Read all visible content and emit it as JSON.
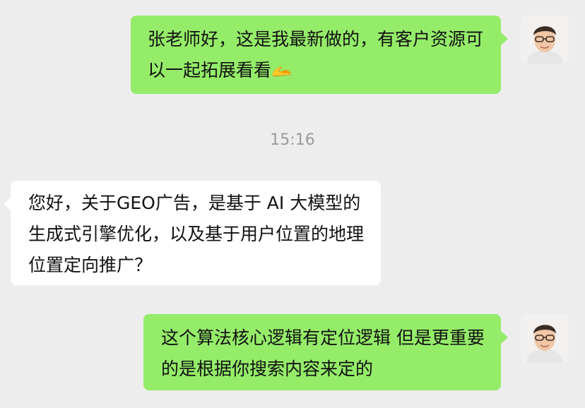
{
  "messages": [
    {
      "direction": "outgoing",
      "text": "张老师好，这是我最新做的，有客户资源可以一起拓展看看",
      "emoji": "🫴",
      "avatar": "avatar-photo"
    },
    {
      "direction": "incoming",
      "text": "您好，关于GEO广告，是基于 AI 大模型的生成式引擎优化，以及基于用户位置的地理位置定向推广？"
    },
    {
      "direction": "outgoing",
      "text": "这个算法核心逻辑有定位逻辑 但是更重要的是根据你搜索内容来定的",
      "avatar": "avatar-photo"
    }
  ],
  "timestamp": "15:16",
  "colors": {
    "background": "#ededed",
    "outgoing_bubble": "#95ec69",
    "incoming_bubble": "#ffffff"
  }
}
